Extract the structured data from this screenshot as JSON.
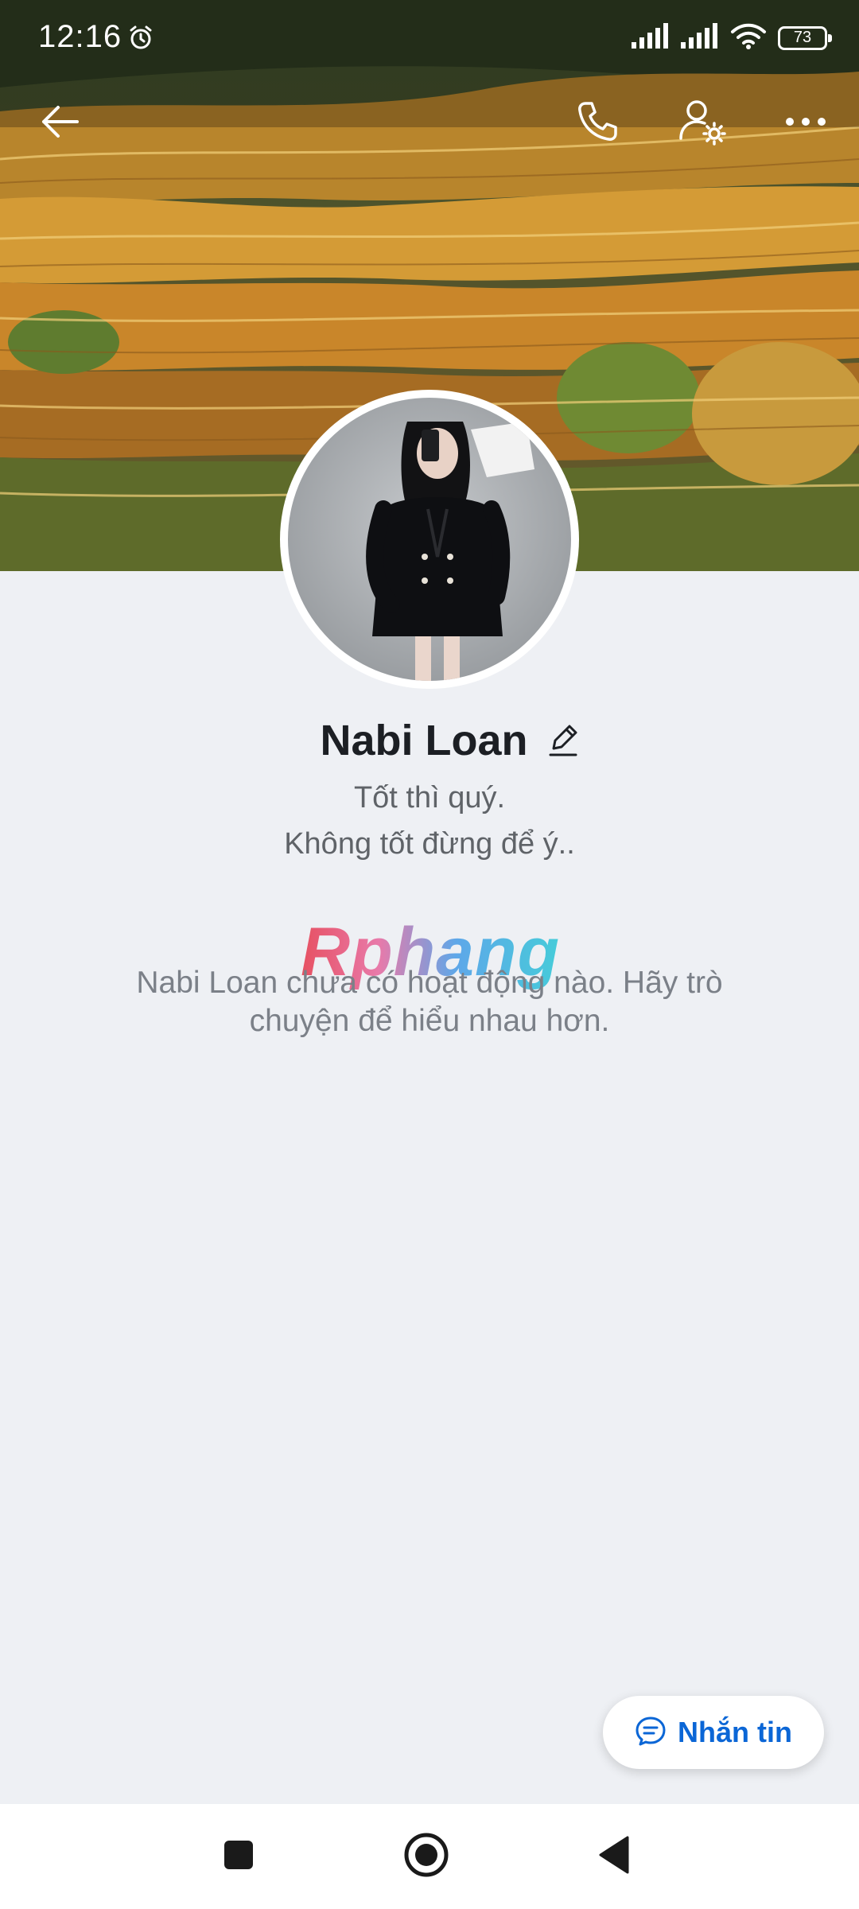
{
  "status_bar": {
    "time": "12:16",
    "battery_level": "73",
    "icons": [
      "alarm-icon",
      "signal-icon",
      "signal-icon",
      "wifi-icon",
      "battery-icon"
    ]
  },
  "header": {
    "back_icon": "arrow-left-icon",
    "call_icon": "phone-icon",
    "settings_icon": "user-gear-icon",
    "more_icon": "more-horizontal-icon"
  },
  "profile": {
    "name": "Nabi Loan",
    "bio_line_1": "Tốt thì quý.",
    "bio_line_2": "Không tốt đừng để ý..",
    "edit_icon": "pencil-icon"
  },
  "watermark": "Rphang",
  "activity": {
    "empty_message": "Nabi Loan chưa có hoạt động nào. Hãy trò chuyện để hiểu nhau hơn."
  },
  "actions": {
    "message_label": "Nhắn tin",
    "message_icon": "chat-bubble-icon"
  },
  "nav": {
    "items": [
      "recents-icon",
      "home-icon",
      "back-triangle-icon"
    ]
  },
  "colors": {
    "accent": "#0b66d6",
    "background": "#eef0f4"
  }
}
